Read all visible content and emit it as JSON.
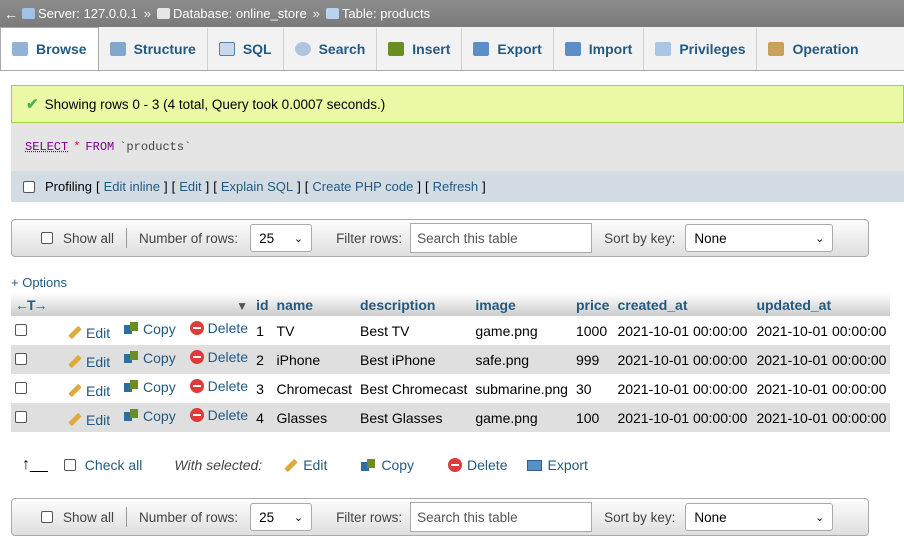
{
  "breadcrumb": {
    "back_glyph": "←",
    "separator": "»",
    "items": [
      {
        "label": "Server: 127.0.0.1",
        "icon": "server-icon"
      },
      {
        "label": "Database: online_store",
        "icon": "database-icon"
      },
      {
        "label": "Table: products",
        "icon": "table-icon"
      }
    ]
  },
  "tabs": [
    {
      "label": "Browse",
      "icon": "browse-icon",
      "active": true
    },
    {
      "label": "Structure",
      "icon": "structure-icon"
    },
    {
      "label": "SQL",
      "icon": "sql-icon"
    },
    {
      "label": "Search",
      "icon": "search-icon"
    },
    {
      "label": "Insert",
      "icon": "insert-icon"
    },
    {
      "label": "Export",
      "icon": "export-icon"
    },
    {
      "label": "Import",
      "icon": "import-icon"
    },
    {
      "label": "Privileges",
      "icon": "privileges-icon"
    },
    {
      "label": "Operation",
      "icon": "operations-icon"
    }
  ],
  "message": {
    "text": "Showing rows 0 - 3 (4 total, Query took 0.0007 seconds.)",
    "icon": "success-check-icon"
  },
  "sql": {
    "select": "SELECT",
    "star": "*",
    "from": "FROM",
    "table": "`products`"
  },
  "profiling": {
    "label": "Profiling",
    "links": [
      "Edit inline",
      "Edit",
      "Explain SQL",
      "Create PHP code",
      "Refresh"
    ]
  },
  "navbar": {
    "show_all": "Show all",
    "rows_label": "Number of rows:",
    "rows_value": "25",
    "filter_label": "Filter rows:",
    "filter_placeholder": "Search this table",
    "sort_label": "Sort by key:",
    "sort_value": "None"
  },
  "options_link": "+ Options",
  "table": {
    "sort_arrows": "←T→",
    "sort_indicator": "▼",
    "columns": [
      "id",
      "name",
      "description",
      "image",
      "price",
      "created_at",
      "updated_at"
    ],
    "actions": {
      "edit": "Edit",
      "copy": "Copy",
      "delete": "Delete"
    },
    "rows": [
      [
        "1",
        "TV",
        "Best TV",
        "game.png",
        "1000",
        "2021-10-01 00:00:00",
        "2021-10-01 00:00:00"
      ],
      [
        "2",
        "iPhone",
        "Best iPhone",
        "safe.png",
        "999",
        "2021-10-01 00:00:00",
        "2021-10-01 00:00:00"
      ],
      [
        "3",
        "Chromecast",
        "Best Chromecast",
        "submarine.png",
        "30",
        "2021-10-01 00:00:00",
        "2021-10-01 00:00:00"
      ],
      [
        "4",
        "Glasses",
        "Best Glasses",
        "game.png",
        "100",
        "2021-10-01 00:00:00",
        "2021-10-01 00:00:00"
      ]
    ]
  },
  "bottom": {
    "arrow_glyph": "↑__",
    "check_all": "Check all",
    "with_selected": "With selected:",
    "edit": "Edit",
    "copy": "Copy",
    "delete": "Delete",
    "export": "Export"
  }
}
